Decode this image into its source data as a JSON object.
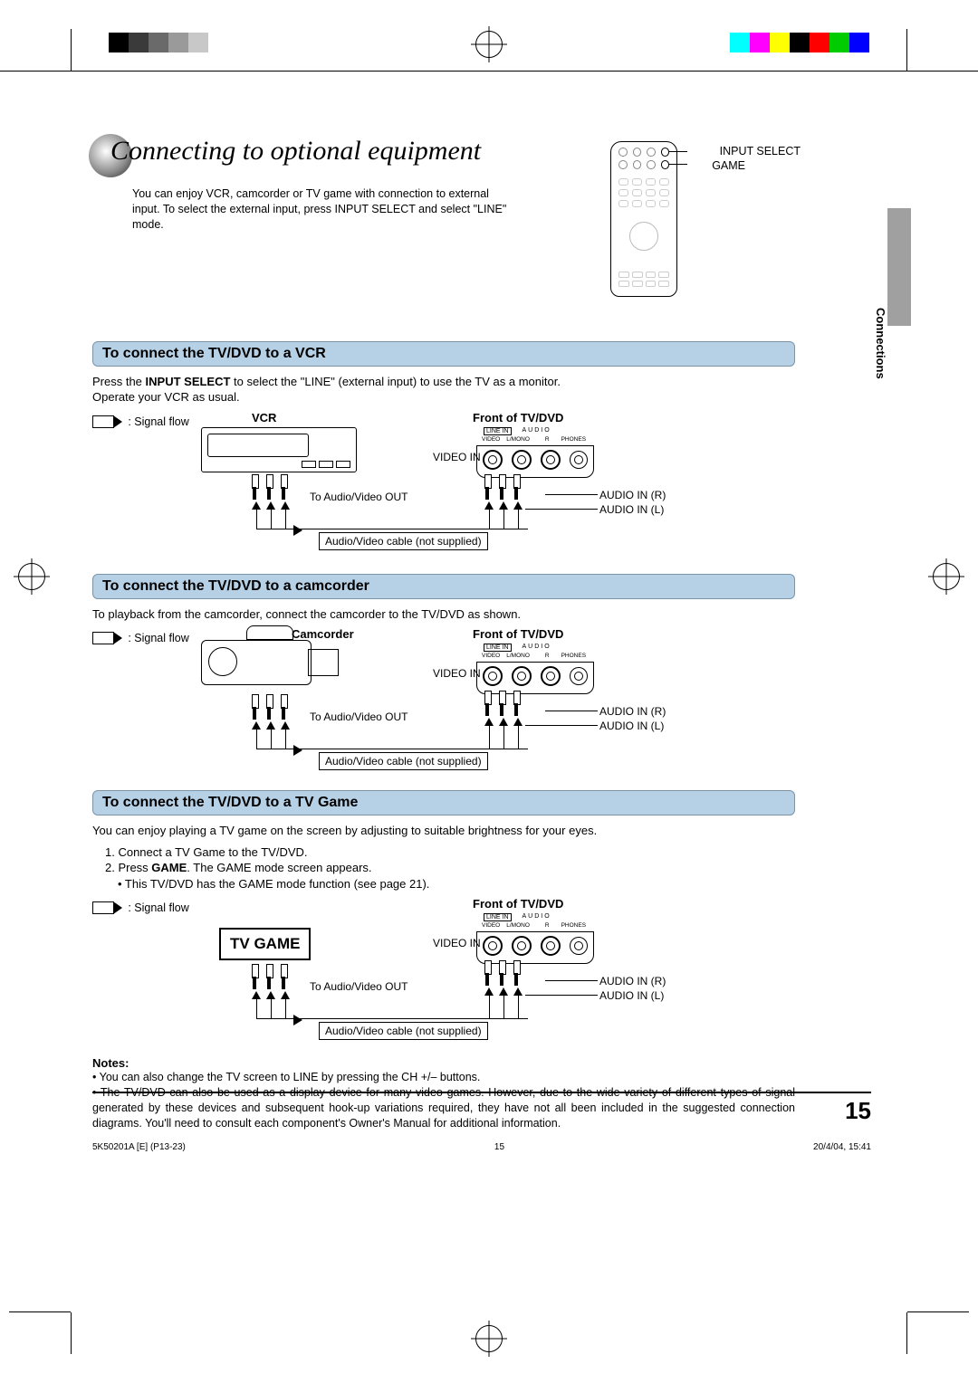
{
  "title": "Connecting to optional equipment",
  "intro_lines": [
    "You can enjoy VCR, camcorder or TV game with connection to external",
    "input. To select the external input, press INPUT SELECT and select \"LINE\"",
    "mode."
  ],
  "remote": {
    "label_input_select": "INPUT SELECT",
    "label_game": "GAME"
  },
  "side_tab": "Connections",
  "section_vcr": {
    "title": "To connect the TV/DVD to a VCR",
    "body_prefix": "Press the ",
    "body_bold": "INPUT SELECT",
    "body_suffix": " to select the \"LINE\" (external input) to use the TV as a monitor.",
    "body_line2": "Operate your VCR as usual.",
    "signal_flow": ": Signal flow",
    "device_label": "VCR",
    "front_label": "Front of TV/DVD",
    "video_in": "VIDEO IN",
    "audio_r": "AUDIO IN (R)",
    "audio_l": "AUDIO IN (L)",
    "to_av_out": "To Audio/Video OUT",
    "cable_label": "Audio/Video cable (not supplied)",
    "port_linein": "LINE IN",
    "port_audio": "AUDIO",
    "port_video": "VIDEO",
    "port_lmono": "L/MONO",
    "port_r": "R",
    "port_phones": "PHONES"
  },
  "section_cam": {
    "title": "To connect the TV/DVD to a camcorder",
    "body": "To playback from the camcorder, connect the camcorder to the TV/DVD as shown.",
    "signal_flow": ": Signal flow",
    "device_label": "Camcorder",
    "front_label": "Front of TV/DVD",
    "video_in": "VIDEO IN",
    "audio_r": "AUDIO IN (R)",
    "audio_l": "AUDIO IN (L)",
    "to_av_out": "To Audio/Video OUT",
    "cable_label": "Audio/Video cable (not supplied)",
    "port_linein": "LINE IN",
    "port_audio": "AUDIO",
    "port_video": "VIDEO",
    "port_lmono": "L/MONO",
    "port_r": "R",
    "port_phones": "PHONES"
  },
  "section_game": {
    "title": "To connect the TV/DVD to a TV Game",
    "body": "You can enjoy playing a TV game on the screen by adjusting to suitable brightness for your eyes.",
    "step1": "1. Connect a TV Game to the TV/DVD.",
    "step2_prefix": "2. Press ",
    "step2_bold": "GAME",
    "step2_suffix": ". The GAME mode screen appears.",
    "step_bullet": "• This TV/DVD has the GAME mode function (see page 21).",
    "signal_flow": ": Signal flow",
    "device_label": "TV GAME",
    "front_label": "Front of TV/DVD",
    "video_in": "VIDEO IN",
    "audio_r": "AUDIO IN (R)",
    "audio_l": "AUDIO IN (L)",
    "to_av_out": "To Audio/Video OUT",
    "cable_label": "Audio/Video cable (not supplied)",
    "port_linein": "LINE IN",
    "port_audio": "AUDIO",
    "port_video": "VIDEO",
    "port_lmono": "L/MONO",
    "port_r": "R",
    "port_phones": "PHONES"
  },
  "notes": {
    "header": "Notes:",
    "item1": "• You can also change the TV screen to LINE by pressing the CH +/– buttons.",
    "item2": "• The TV/DVD can also be used as a display device for many video games. However, due to the wide variety of different types of signal generated by these devices and subsequent hook-up variations required, they have not all been included in the suggested connection diagrams. You'll need to consult each component's Owner's Manual for additional information."
  },
  "page_number": "15",
  "footer": {
    "left": "5K50201A [E] (P13-23)",
    "mid": "15",
    "right": "20/4/04, 15:41"
  }
}
